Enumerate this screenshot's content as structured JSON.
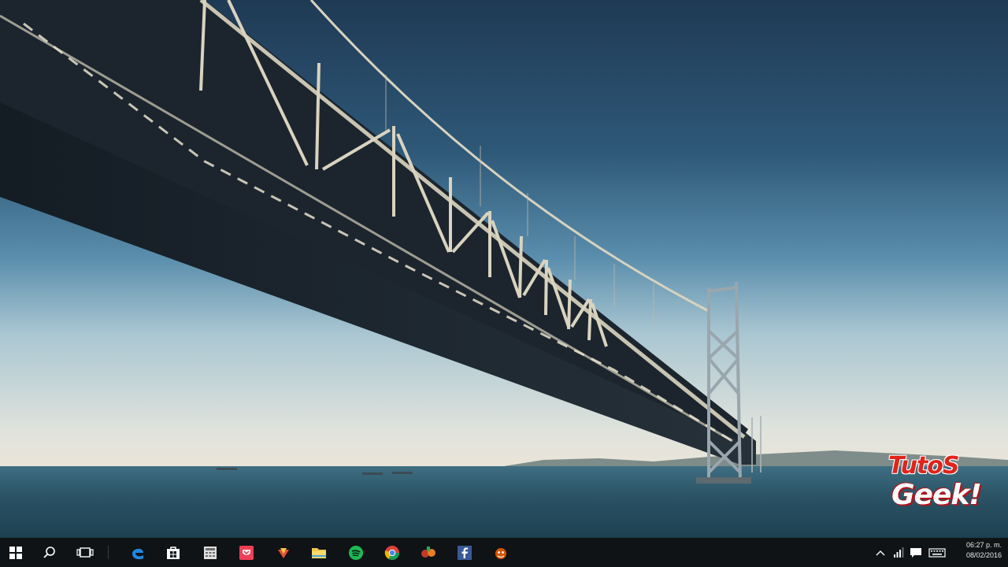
{
  "watermark": {
    "line1": "TutoS",
    "line2": "Geek!"
  },
  "taskbar": {
    "items": [
      {
        "name": "start-button",
        "icon": "windows-logo-icon"
      },
      {
        "name": "search-button",
        "icon": "search-icon"
      },
      {
        "name": "task-view-button",
        "icon": "task-view-icon"
      },
      {
        "name": "edge-button",
        "icon": "edge-icon"
      },
      {
        "name": "store-button",
        "icon": "store-icon"
      },
      {
        "name": "calculator-button",
        "icon": "calculator-icon"
      },
      {
        "name": "pocket-button",
        "icon": "pocket-icon"
      },
      {
        "name": "app-button",
        "icon": "app-icon"
      },
      {
        "name": "file-explorer-button",
        "icon": "folder-icon"
      },
      {
        "name": "spotify-button",
        "icon": "spotify-icon"
      },
      {
        "name": "chrome-button",
        "icon": "chrome-icon"
      },
      {
        "name": "game-button",
        "icon": "game-icon"
      },
      {
        "name": "facebook-button",
        "icon": "facebook-icon"
      },
      {
        "name": "extra-app-button",
        "icon": "app-icon"
      }
    ],
    "tray": {
      "time": "06:27 p. m.",
      "date": "08/02/2016"
    }
  }
}
